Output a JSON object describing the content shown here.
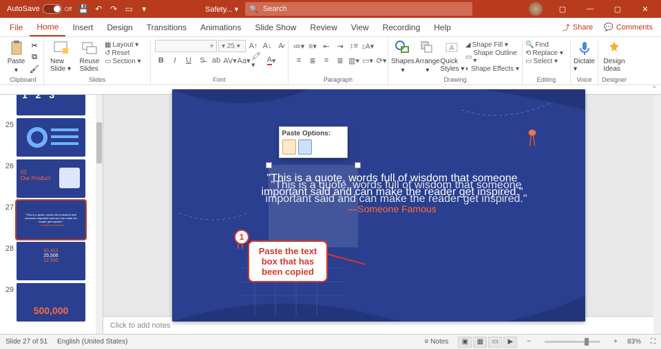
{
  "titlebar": {
    "autosave_label": "AutoSave",
    "autosave_state": "Off",
    "doc_name": "Safety... ▾",
    "search_placeholder": "Search"
  },
  "menu": {
    "file": "File",
    "home": "Home",
    "insert": "Insert",
    "design": "Design",
    "transitions": "Transitions",
    "animations": "Animations",
    "slideshow": "Slide Show",
    "review": "Review",
    "view": "View",
    "recording": "Recording",
    "help": "Help",
    "share": "Share",
    "comments": "Comments"
  },
  "ribbon": {
    "clipboard": {
      "label": "Clipboard",
      "paste": "Paste"
    },
    "slides": {
      "label": "Slides",
      "new_slide": "New\nSlide ▾",
      "reuse": "Reuse\nSlides",
      "layout": "Layout ▾",
      "reset": "Reset",
      "section": "Section ▾"
    },
    "font": {
      "label": "Font",
      "size": "▾ 25  ▾"
    },
    "paragraph": {
      "label": "Paragraph"
    },
    "drawing": {
      "label": "Drawing",
      "shapes": "Shapes",
      "arrange": "Arrange",
      "quick": "Quick\nStyles ▾",
      "shape_fill": "Shape Fill ▾",
      "shape_outline": "Shape Outline ▾",
      "shape_effects": "Shape Effects ▾"
    },
    "editing": {
      "label": "Editing",
      "find": "Find",
      "replace": "Replace ▾",
      "select": "Select ▾"
    },
    "voice": {
      "label": "Voice",
      "dictate": "Dictate\n▾"
    },
    "designer": {
      "label": "Designer",
      "ideas": "Design\nIdeas"
    }
  },
  "thumbs": [
    {
      "num": "",
      "content": "123"
    },
    {
      "num": "25",
      "content": "chart"
    },
    {
      "num": "26",
      "content": "product"
    },
    {
      "num": "27",
      "content": "quote",
      "active": true
    },
    {
      "num": "28",
      "content": "stats"
    },
    {
      "num": "29",
      "content": "500k"
    }
  ],
  "slide": {
    "paste_header": "Paste Options:",
    "quote": "\"This is a quote, words full of wisdom that someone important said and can make the reader get inspired.\"",
    "attribution": "—Someone Famous"
  },
  "callout": {
    "num": "1",
    "text": "Paste the text box that has been copied"
  },
  "notes_placeholder": "Click to add notes",
  "status": {
    "slide_count": "Slide 27 of 51",
    "language": "English (United States)",
    "notes": "Notes",
    "zoom": "83%"
  }
}
